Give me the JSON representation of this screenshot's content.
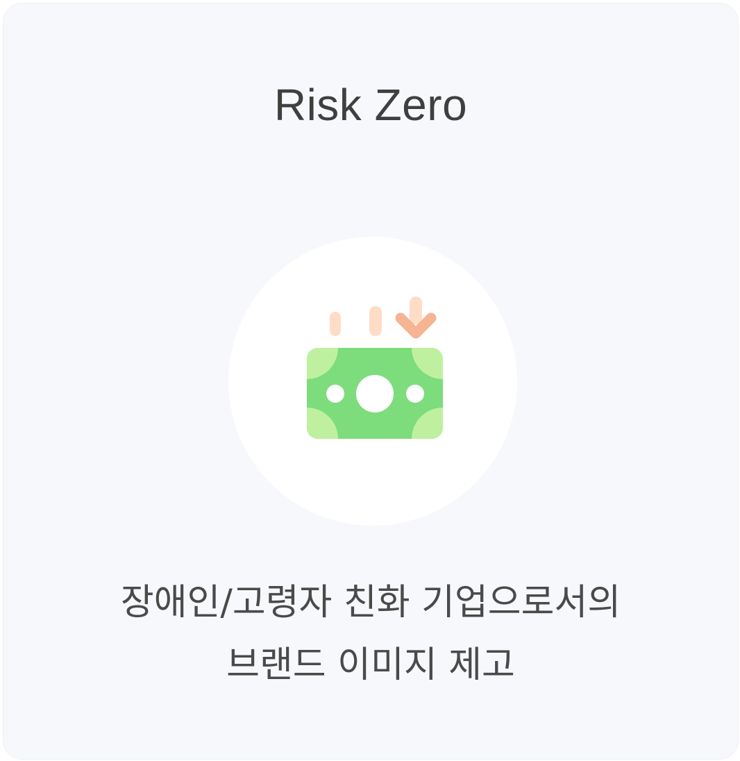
{
  "card": {
    "title": "Risk Zero",
    "description_lines": [
      "장애인/고령자 친화 기업으로서의",
      "브랜드 이미지 제고"
    ]
  },
  "icon": {
    "name": "money-bill-down-arrow-icon",
    "colors": {
      "bill": "#7ddc7b",
      "bill_corner": "#bff0a0",
      "bill_hole": "#ffffff",
      "stream": "#ffdcc6",
      "arrow": "#f6b493"
    }
  }
}
